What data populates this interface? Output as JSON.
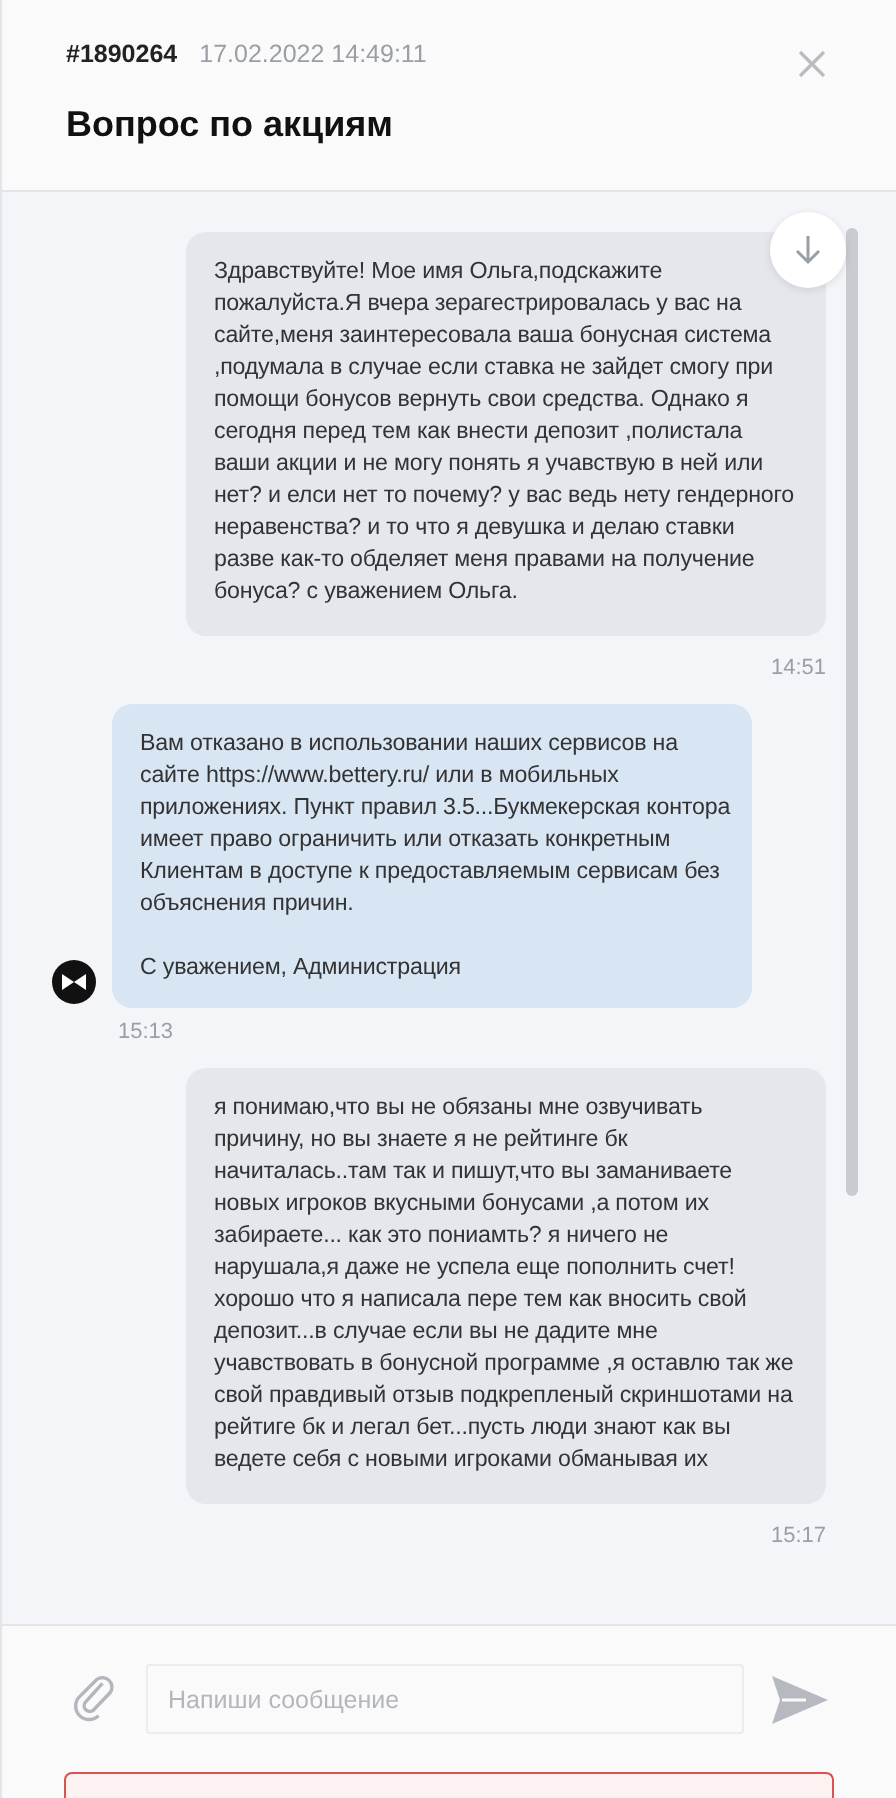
{
  "header": {
    "ticket_id": "#1890264",
    "datetime": "17.02.2022 14:49:11",
    "title": "Вопрос по акциям"
  },
  "messages": [
    {
      "kind": "user",
      "text": "Здравствуйте! Мое имя Ольга,подскажите пожалуйста.Я вчера зерагестрировалась у вас на сайте,меня заинтересовала ваша бонусная система ,подумала в случае если ставка не зайдет смогу при помощи бонусов вернуть свои средства. Однако я сегодня перед тем как внести депозит ,полистала ваши акции и не могу понять я учавствую в ней или нет?  и елси нет то почему? у вас ведь нету гендерного неравенства? и то что я девушка и делаю ставки разве как-то обделяет меня правами на получение бонуса? с уважением Ольга.",
      "time": "14:51"
    },
    {
      "kind": "admin",
      "text": "Вам отказано в использовании наших сервисов на сайте https://www.bettery.ru/ или в мобильных приложениях.  Пункт правил 3.5...Букмекерская контора имеет право ограничить или отказать конкретным Клиентам в доступе к предоставляемым сервисам без объяснения причин.\n\nС уважением, Администрация",
      "time": "15:13"
    },
    {
      "kind": "user",
      "text": "я понимаю,что вы не обязаны мне озвучивать причину, но вы знаете я не рейтинге бк начиталась..там так и пишут,что вы заманиваете новых игроков вкусными бонусами ,а потом их забираете... как это пониамть? я ничего не нарушала,я даже не успела еще пополнить счет! хорошо что я написала пере тем как вносить свой депозит...в случае если вы не дадите мне учавствовать в бонусной программе ,я оставлю так же свой правдивый отзыв подкрепленый скриншотами на рейтиге бк и легал бет...пусть люди знают как вы ведете себя с новыми игроками обманывая их",
      "time": "15:17"
    }
  ],
  "composer": {
    "placeholder": "Напиши сообщение"
  }
}
